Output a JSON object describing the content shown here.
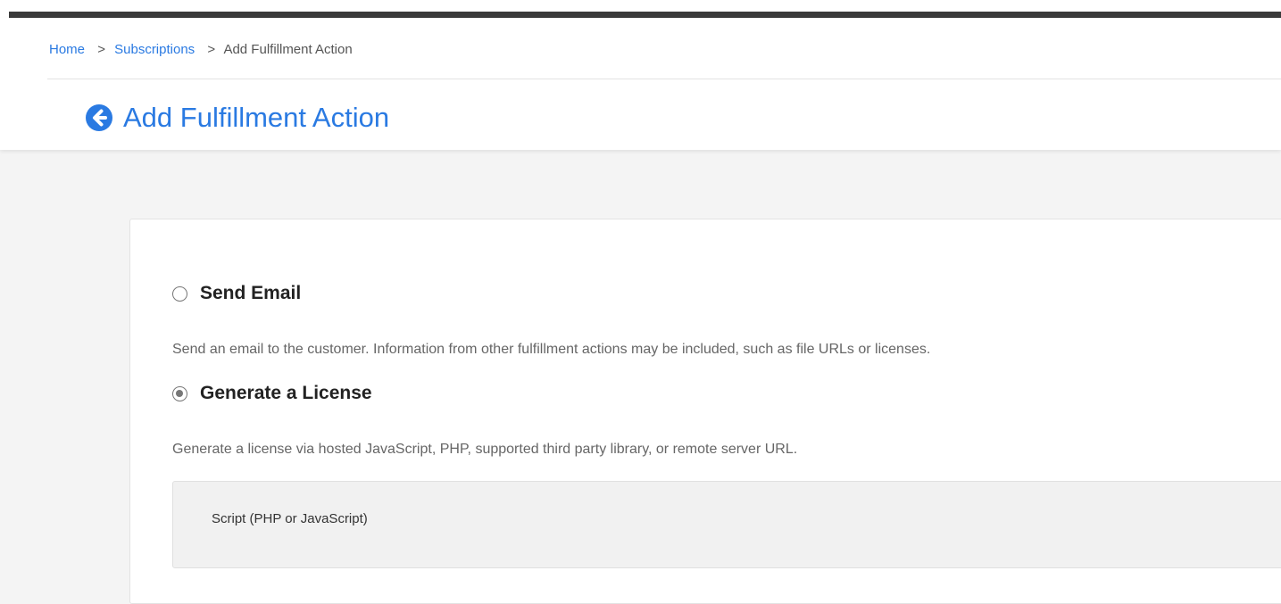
{
  "breadcrumb": {
    "home": "Home",
    "subscriptions": "Subscriptions",
    "current": "Add Fulfillment Action",
    "separator": ">"
  },
  "page": {
    "title": "Add Fulfillment Action",
    "back_icon": "arrow-circle-left-icon"
  },
  "options": {
    "send_email": {
      "label": "Send Email",
      "description": "Send an email to the customer. Information from other fulfillment actions may be included, such as file URLs or licenses.",
      "selected": false
    },
    "generate_license": {
      "label": "Generate a License",
      "description": "Generate a license via hosted JavaScript, PHP, supported third party library, or remote server URL.",
      "selected": true
    }
  },
  "license_type": {
    "script_label": "Script (PHP or JavaScript)"
  },
  "colors": {
    "accent": "#2a7ae2",
    "background": "#f4f4f4",
    "topbar": "#3a3a3a"
  }
}
